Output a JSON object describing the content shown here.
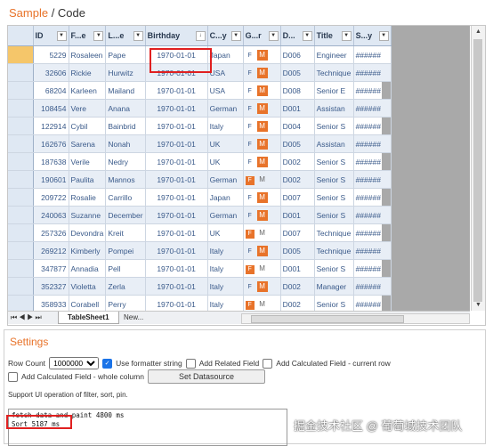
{
  "breadcrumb": {
    "sample": "Sample",
    "sep": " / ",
    "code": "Code"
  },
  "grid": {
    "columns": [
      {
        "key": "id",
        "label": "ID"
      },
      {
        "key": "first",
        "label": "F...e"
      },
      {
        "key": "last",
        "label": "L...e"
      },
      {
        "key": "birthday",
        "label": "Birthday"
      },
      {
        "key": "country",
        "label": "C...y"
      },
      {
        "key": "gender",
        "label": "G...r"
      },
      {
        "key": "dept",
        "label": "D..."
      },
      {
        "key": "title",
        "label": "Title"
      },
      {
        "key": "salary",
        "label": "S...y"
      }
    ],
    "birthday_sort_indicator": "↓",
    "rows": [
      {
        "id": "5229",
        "first": "Rosaleen",
        "last": "Pape",
        "birthday": "1970-01-01",
        "country": "Japan",
        "gender": "M",
        "dept": "D006",
        "title": "Engineer",
        "salary": "######"
      },
      {
        "id": "32606",
        "first": "Rickie",
        "last": "Hurwitz",
        "birthday": "1970-01-01",
        "country": "USA",
        "gender": "M",
        "dept": "D005",
        "title": "Technique",
        "salary": "######"
      },
      {
        "id": "68204",
        "first": "Karleen",
        "last": "Mailand",
        "birthday": "1970-01-01",
        "country": "USA",
        "gender": "M",
        "dept": "D008",
        "title": "Senior E",
        "salary": "######"
      },
      {
        "id": "108454",
        "first": "Vere",
        "last": "Anana",
        "birthday": "1970-01-01",
        "country": "German",
        "gender": "M",
        "dept": "D001",
        "title": "Assistan",
        "salary": "######"
      },
      {
        "id": "122914",
        "first": "Cybil",
        "last": "Bainbrid",
        "birthday": "1970-01-01",
        "country": "Italy",
        "gender": "M",
        "dept": "D004",
        "title": "Senior S",
        "salary": "######"
      },
      {
        "id": "162676",
        "first": "Sarena",
        "last": "Nonah",
        "birthday": "1970-01-01",
        "country": "UK",
        "gender": "M",
        "dept": "D005",
        "title": "Assistan",
        "salary": "######"
      },
      {
        "id": "187638",
        "first": "Verile",
        "last": "Nedry",
        "birthday": "1970-01-01",
        "country": "UK",
        "gender": "M",
        "dept": "D002",
        "title": "Senior S",
        "salary": "######"
      },
      {
        "id": "190601",
        "first": "Paulita",
        "last": "Mannos",
        "birthday": "1970-01-01",
        "country": "German",
        "gender": "F",
        "dept": "D002",
        "title": "Senior S",
        "salary": "######"
      },
      {
        "id": "209722",
        "first": "Rosalie",
        "last": "Carrillo",
        "birthday": "1970-01-01",
        "country": "Japan",
        "gender": "M",
        "dept": "D007",
        "title": "Senior S",
        "salary": "######"
      },
      {
        "id": "240063",
        "first": "Suzanne",
        "last": "December",
        "birthday": "1970-01-01",
        "country": "German",
        "gender": "M",
        "dept": "D001",
        "title": "Senior S",
        "salary": "######"
      },
      {
        "id": "257326",
        "first": "Devondra",
        "last": "Kreit",
        "birthday": "1970-01-01",
        "country": "UK",
        "gender": "F",
        "dept": "D007",
        "title": "Technique",
        "salary": "######"
      },
      {
        "id": "269212",
        "first": "Kimberly",
        "last": "Pompei",
        "birthday": "1970-01-01",
        "country": "Italy",
        "gender": "M",
        "dept": "D005",
        "title": "Technique",
        "salary": "######"
      },
      {
        "id": "347877",
        "first": "Annadia",
        "last": "Pell",
        "birthday": "1970-01-01",
        "country": "Italy",
        "gender": "F",
        "dept": "D001",
        "title": "Senior S",
        "salary": "######"
      },
      {
        "id": "352327",
        "first": "Violetta",
        "last": "Zerla",
        "birthday": "1970-01-01",
        "country": "Italy",
        "gender": "M",
        "dept": "D002",
        "title": "Manager",
        "salary": "######"
      },
      {
        "id": "358933",
        "first": "Corabell",
        "last": "Perry",
        "birthday": "1970-01-01",
        "country": "Italy",
        "gender": "F",
        "dept": "D002",
        "title": "Senior S",
        "salary": "######"
      }
    ],
    "gender_f": "F",
    "gender_m": "M",
    "sheet_tab": "TableSheet1",
    "new_tab": "New..."
  },
  "settings": {
    "title": "Settings",
    "row_count_label": "Row Count",
    "row_count_value": "1000000",
    "use_formatter_label": "Use formatter string",
    "add_related_label": "Add Related Field",
    "add_calc_current_label": "Add Calculated Field - current row",
    "add_calc_whole_label": "Add Calculated Field - whole column",
    "set_datasource_label": "Set Datasource",
    "support_text": "Support UI operation of filter, sort, pin.",
    "log_line1": "fetch data and paint 4800 ms",
    "log_line2": "Sort 5187 ms"
  },
  "watermark": "掘金技术社区 @ 葡萄城技术团队",
  "colors": {
    "accent": "#e8732a",
    "highlight": "#e02020",
    "header_bg": "#dfe8f3"
  }
}
